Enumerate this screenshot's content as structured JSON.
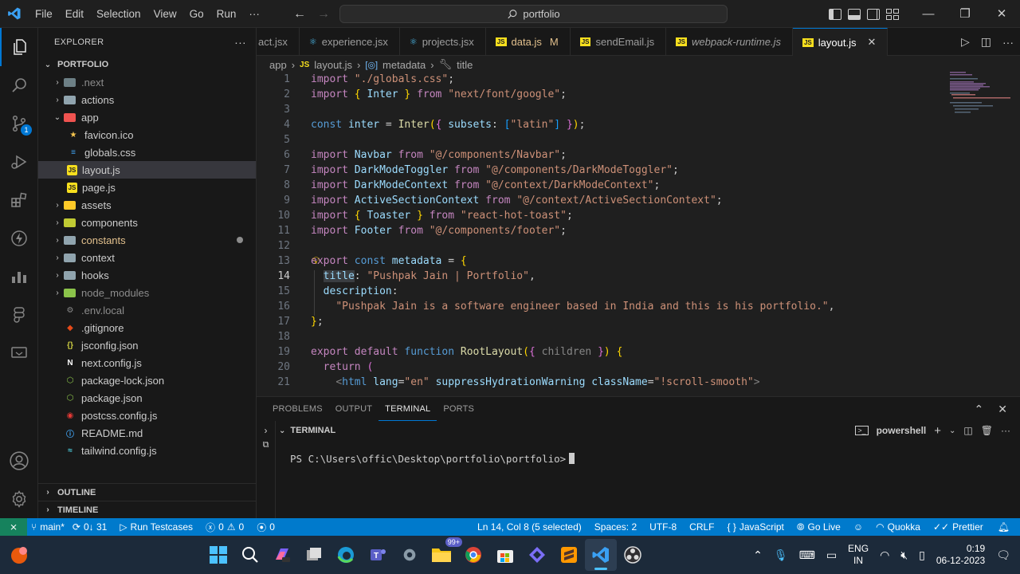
{
  "menu": [
    "File",
    "Edit",
    "Selection",
    "View",
    "Go",
    "Run",
    "···"
  ],
  "search": {
    "label": "portfolio"
  },
  "explorer": {
    "title": "EXPLORER",
    "root": "PORTFOLIO",
    "items": [
      {
        "label": ".next",
        "level": 0,
        "type": "folder",
        "open": false,
        "dim": true,
        "color": "#6d8086"
      },
      {
        "label": "actions",
        "level": 0,
        "type": "folder",
        "open": false,
        "dim": false,
        "color": "#90a4ae"
      },
      {
        "label": "app",
        "level": 0,
        "type": "folder",
        "open": true,
        "dim": false,
        "color": "#ef5350"
      },
      {
        "label": "favicon.ico",
        "level": 1,
        "type": "file",
        "icon": "★",
        "iconColor": "#f9c74f",
        "dim": false
      },
      {
        "label": "globals.css",
        "level": 1,
        "type": "file",
        "icon": "≡",
        "iconColor": "#42a5f5",
        "dim": false
      },
      {
        "label": "layout.js",
        "level": 1,
        "type": "file",
        "icon": "JS",
        "iconColor": "#f7df1e",
        "dim": false,
        "selected": true
      },
      {
        "label": "page.js",
        "level": 1,
        "type": "file",
        "icon": "JS",
        "iconColor": "#f7df1e",
        "dim": false
      },
      {
        "label": "assets",
        "level": 0,
        "type": "folder",
        "open": false,
        "dim": false,
        "color": "#ffca28"
      },
      {
        "label": "components",
        "level": 0,
        "type": "folder",
        "open": false,
        "dim": false,
        "color": "#c0ca33"
      },
      {
        "label": "constants",
        "level": 0,
        "type": "folder",
        "open": false,
        "dim": false,
        "color": "#90a4ae",
        "modified": true,
        "labelColor": "#e2c08d"
      },
      {
        "label": "context",
        "level": 0,
        "type": "folder",
        "open": false,
        "dim": false,
        "color": "#90a4ae"
      },
      {
        "label": "hooks",
        "level": 0,
        "type": "folder",
        "open": false,
        "dim": false,
        "color": "#90a4ae"
      },
      {
        "label": "node_modules",
        "level": 0,
        "type": "folder",
        "open": false,
        "dim": true,
        "color": "#8bc34a"
      },
      {
        "label": ".env.local",
        "level": 0,
        "type": "file",
        "icon": "⚙",
        "iconColor": "#8c8c8c",
        "dim": true
      },
      {
        "label": ".gitignore",
        "level": 0,
        "type": "file",
        "icon": "◆",
        "iconColor": "#e64a19",
        "dim": false
      },
      {
        "label": "jsconfig.json",
        "level": 0,
        "type": "file",
        "icon": "{}",
        "iconColor": "#cbcb41",
        "dim": false
      },
      {
        "label": "next.config.js",
        "level": 0,
        "type": "file",
        "icon": "N",
        "iconColor": "#ffffff",
        "dim": false
      },
      {
        "label": "package-lock.json",
        "level": 0,
        "type": "file",
        "icon": "⬡",
        "iconColor": "#8bc34a",
        "dim": false
      },
      {
        "label": "package.json",
        "level": 0,
        "type": "file",
        "icon": "⬡",
        "iconColor": "#8bc34a",
        "dim": false
      },
      {
        "label": "postcss.config.js",
        "level": 0,
        "type": "file",
        "icon": "◉",
        "iconColor": "#e53935",
        "dim": false
      },
      {
        "label": "README.md",
        "level": 0,
        "type": "file",
        "icon": "ⓘ",
        "iconColor": "#42a5f5",
        "dim": false
      },
      {
        "label": "tailwind.config.js",
        "level": 0,
        "type": "file",
        "icon": "≈",
        "iconColor": "#4dd0e1",
        "dim": false
      }
    ],
    "outline": "OUTLINE",
    "timeline": "TIMELINE"
  },
  "tabs": [
    {
      "label": "act.jsx",
      "icon": "⚛",
      "iconColor": "#4fc3f7",
      "italic": false
    },
    {
      "label": "experience.jsx",
      "icon": "⚛",
      "iconColor": "#4fc3f7",
      "italic": false
    },
    {
      "label": "projects.jsx",
      "icon": "⚛",
      "iconColor": "#4fc3f7",
      "italic": false
    },
    {
      "label": "data.js",
      "icon": "JS",
      "iconColor": "#f7df1e",
      "italic": false,
      "modified": "M",
      "labelColor": "#e2c08d"
    },
    {
      "label": "sendEmail.js",
      "icon": "JS",
      "iconColor": "#f7df1e",
      "italic": false
    },
    {
      "label": "webpack-runtime.js",
      "icon": "JS",
      "iconColor": "#f7df1e",
      "italic": true
    },
    {
      "label": "layout.js",
      "icon": "JS",
      "iconColor": "#f7df1e",
      "italic": false,
      "active": true
    }
  ],
  "breadcrumbs": {
    "a": "app",
    "b": "layout.js",
    "c": "metadata",
    "d": "title"
  },
  "code": {
    "line_numbers": [
      "1",
      "2",
      "3",
      "4",
      "5",
      "6",
      "7",
      "8",
      "9",
      "10",
      "11",
      "12",
      "13",
      "14",
      "15",
      "16",
      "17",
      "18",
      "19",
      "20",
      "21"
    ],
    "current_line": "14"
  },
  "panel": {
    "tabs": [
      "PROBLEMS",
      "OUTPUT",
      "TERMINAL",
      "PORTS"
    ],
    "active": "TERMINAL",
    "terminal_title": "TERMINAL",
    "shell": "powershell",
    "prompt": "PS C:\\Users\\offic\\Desktop\\portfolio\\portfolio>"
  },
  "status": {
    "branch": "main*",
    "sync": "0↓ 31",
    "run": "Run Testcases",
    "errors": "0",
    "warnings": "0",
    "ports": "0",
    "position": "Ln 14, Col 8 (5 selected)",
    "spaces": "Spaces: 2",
    "encoding": "UTF-8",
    "eol": "CRLF",
    "language": "JavaScript",
    "golive": "Go Live",
    "quokka": "Quokka",
    "prettier": "Prettier"
  },
  "taskbar": {
    "badge_teams": "99+",
    "lang": "ENG",
    "region": "IN",
    "time": "0:19",
    "date": "06-12-2023"
  },
  "colors": {
    "accent": "#0078d4",
    "statusbar": "#007acc",
    "remote": "#16825d"
  }
}
